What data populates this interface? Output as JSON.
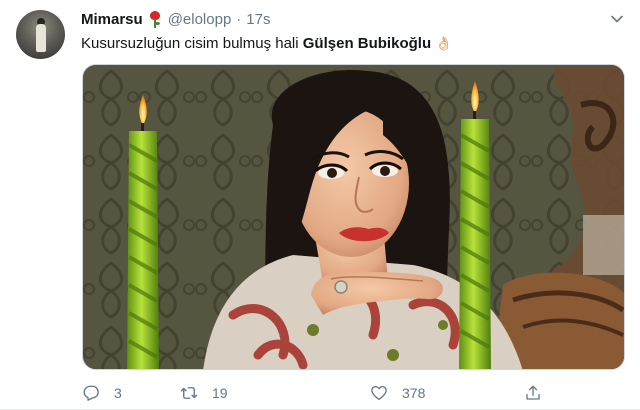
{
  "tweet": {
    "display_name": "Mimarsu",
    "handle": "@elolopp",
    "separator": "·",
    "time": "17s",
    "text_plain": "Kusursuzluğun cisim bulmuş hali ",
    "text_bold": "Gülşen Bubikoğlu",
    "text_emoji": "👌🏻"
  },
  "actions": {
    "reply_count": "3",
    "retweet_count": "19",
    "like_count": "378"
  },
  "icons": {
    "name_emoji": "rose-icon",
    "menu": "chevron-down-icon",
    "reply": "reply-icon",
    "retweet": "retweet-icon",
    "like": "heart-icon",
    "share": "share-icon"
  },
  "colors": {
    "primary_text": "#14171a",
    "secondary_text": "#657786",
    "candle_green": "#8fc21f"
  }
}
